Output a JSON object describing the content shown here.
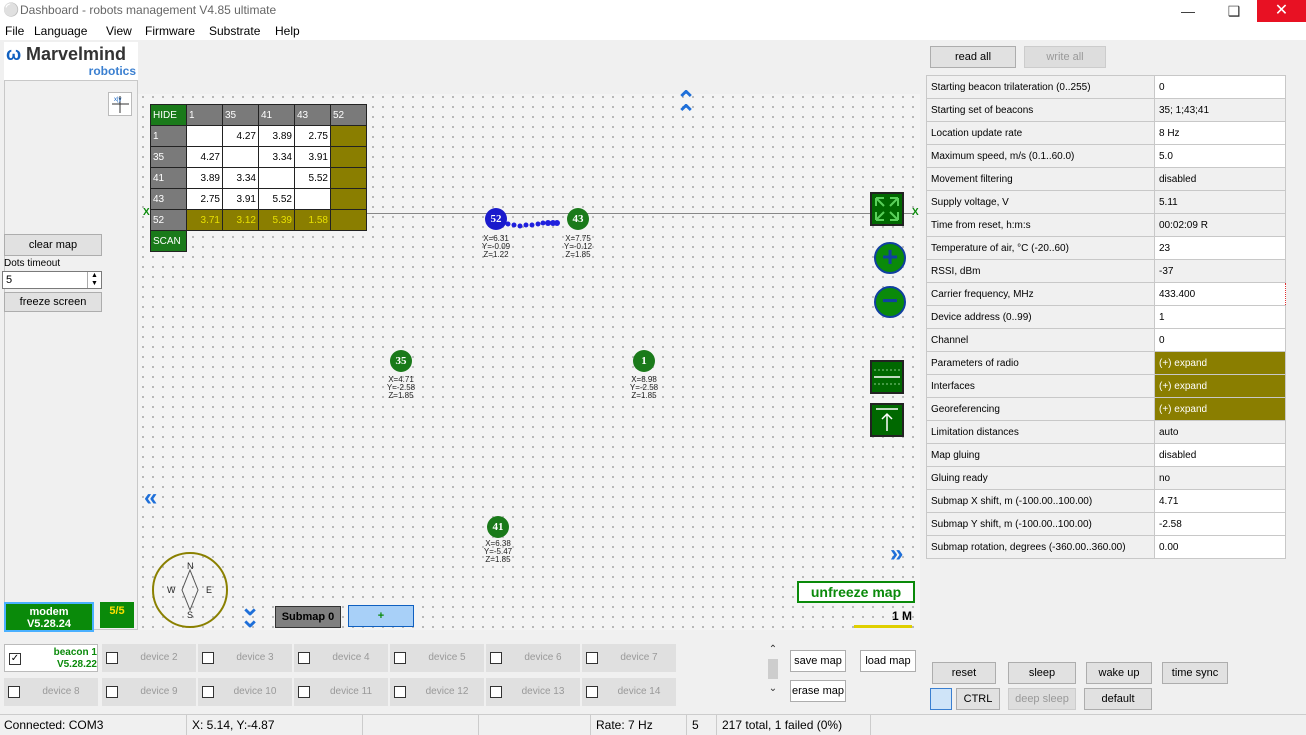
{
  "window": {
    "title": "Dashboard - robots management  V4.85  ultimate"
  },
  "menu": [
    "File",
    "Language",
    "View",
    "Firmware",
    "Substrate",
    "Help"
  ],
  "logo": {
    "main": "Marvelmind",
    "sub": "robotics"
  },
  "left": {
    "clear_map": "clear map",
    "dots_timeout_label": "Dots timeout",
    "dots_timeout_value": "5",
    "freeze_screen": "freeze screen",
    "modem_label": "modem",
    "modem_version": "V5.28.24",
    "count_badge": "5/5"
  },
  "distance_table": {
    "hide": "HIDE",
    "scan": "SCAN",
    "cols": [
      "1",
      "35",
      "41",
      "43",
      "52"
    ],
    "rows": [
      {
        "id": "1",
        "cells": [
          "",
          "4.27",
          "3.89",
          "2.75",
          ""
        ]
      },
      {
        "id": "35",
        "cells": [
          "4.27",
          "",
          "3.34",
          "3.91",
          ""
        ]
      },
      {
        "id": "41",
        "cells": [
          "3.89",
          "3.34",
          "",
          "5.52",
          ""
        ]
      },
      {
        "id": "43",
        "cells": [
          "2.75",
          "3.91",
          "5.52",
          "",
          ""
        ]
      },
      {
        "id": "52",
        "cells": [
          "3.71",
          "3.12",
          "5.39",
          "1.58",
          ""
        ]
      }
    ]
  },
  "beacons": [
    {
      "id": "52",
      "x": "X=6.31",
      "y": "Y=-0.09",
      "z": "Z=1.22"
    },
    {
      "id": "43",
      "x": "X=7.75",
      "y": "Y=-0.12",
      "z": "Z=1.85"
    },
    {
      "id": "35",
      "x": "X=4.71",
      "y": "Y=-2.58",
      "z": "Z=1.85"
    },
    {
      "id": "1",
      "x": "X=8.98",
      "y": "Y=-2.58",
      "z": "Z=1.85"
    },
    {
      "id": "41",
      "x": "X=6.38",
      "y": "Y=-5.47",
      "z": "Z=1.85"
    }
  ],
  "map": {
    "axis_x": "X",
    "axis_x2": "X",
    "compass": {
      "n": "N",
      "s": "S",
      "e": "E",
      "w": "W"
    },
    "submap_label": "Submap 0",
    "plus": "+",
    "unfreeze": "unfreeze map",
    "scale": "1 M",
    "axis_icon_text": "x|y"
  },
  "right": {
    "read_all": "read all",
    "write_all": "write all",
    "props": [
      {
        "name": "Starting beacon trilateration (0..255)",
        "value": "0",
        "style": "w"
      },
      {
        "name": "Starting set of beacons",
        "value": "35;  1;43;41",
        "style": "g"
      },
      {
        "name": "Location update rate",
        "value": "8 Hz",
        "style": "w"
      },
      {
        "name": "Maximum speed, m/s (0.1..60.0)",
        "value": "5.0",
        "style": "w"
      },
      {
        "name": "Movement filtering",
        "value": "disabled",
        "style": "g"
      },
      {
        "name": "Supply voltage, V",
        "value": "5.11",
        "style": "g"
      },
      {
        "name": "Time from reset, h:m:s",
        "value": "00:02:09   R",
        "style": "g"
      },
      {
        "name": "Temperature of air, °C (-20..60)",
        "value": "23",
        "style": "w"
      },
      {
        "name": "RSSI, dBm",
        "value": "-37",
        "style": "g"
      },
      {
        "name": "Carrier frequency, MHz",
        "value": "433.400",
        "style": "red"
      },
      {
        "name": "Device address (0..99)",
        "value": "1",
        "style": "w"
      },
      {
        "name": "Channel",
        "value": "0",
        "style": "w"
      },
      {
        "name": "Parameters of radio",
        "value": "(+) expand",
        "style": "o"
      },
      {
        "name": "Interfaces",
        "value": "(+) expand",
        "style": "o"
      },
      {
        "name": "Georeferencing",
        "value": "(+) expand",
        "style": "o"
      },
      {
        "name": "Limitation distances",
        "value": "auto",
        "style": "g"
      },
      {
        "name": "Map gluing",
        "value": "disabled",
        "style": "w"
      },
      {
        "name": "Gluing ready",
        "value": "no",
        "style": "g"
      },
      {
        "name": "Submap X shift, m (-100.00..100.00)",
        "value": "4.71",
        "style": "w"
      },
      {
        "name": "Submap Y shift, m (-100.00..100.00)",
        "value": "-2.58",
        "style": "w"
      },
      {
        "name": "Submap rotation, degrees (-360.00..360.00)",
        "value": "0.00",
        "style": "w"
      }
    ],
    "reset": "reset",
    "sleep": "sleep",
    "wake_up": "wake up",
    "time_sync": "time sync",
    "ctrl": "CTRL",
    "deep_sleep": "deep sleep",
    "default": "default"
  },
  "devices": {
    "beacon1_name": "beacon 1",
    "beacon1_version": "V5.28.22",
    "row1": [
      "device 2",
      "device 3",
      "device 4",
      "device 5",
      "device 6",
      "device 7"
    ],
    "row2": [
      "device 8",
      "device 9",
      "device 10",
      "device 11",
      "device 12",
      "device 13",
      "device 14"
    ],
    "save_map": "save map",
    "load_map": "load map",
    "erase_map": "erase map"
  },
  "status": {
    "connected": "Connected: COM3",
    "coords": "X: 5.14, Y:-4.87",
    "rate": "Rate: 7 Hz",
    "count": "5",
    "total": "217 total, 1 failed (0%)"
  },
  "colors": {
    "accent_green": "#1a7a1a",
    "olive": "#8a7e00",
    "blue_arrow": "#1e6fd9",
    "close_red": "#e81123"
  }
}
